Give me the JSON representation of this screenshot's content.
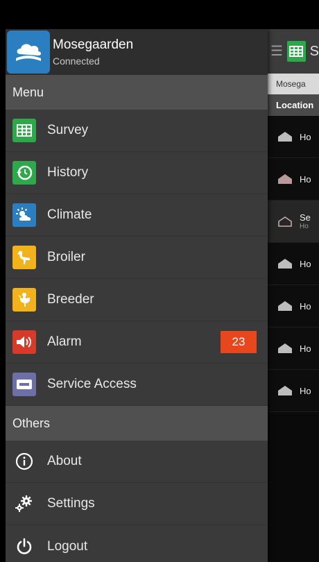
{
  "drawer": {
    "app_title": "Mosegaarden",
    "status": "Connected",
    "menu_section": "Menu",
    "menu_items": [
      {
        "label": "Survey",
        "icon": "grid-icon",
        "color": "#2ea84a"
      },
      {
        "label": "History",
        "icon": "history-icon",
        "color": "#2ea84a"
      },
      {
        "label": "Climate",
        "icon": "climate-icon",
        "color": "#2b7fc1"
      },
      {
        "label": "Broiler",
        "icon": "broiler-icon",
        "color": "#f2b21b"
      },
      {
        "label": "Breeder",
        "icon": "breeder-icon",
        "color": "#f2b21b"
      },
      {
        "label": "Alarm",
        "icon": "alarm-icon",
        "color": "#d83a2a",
        "badge": "23"
      },
      {
        "label": "Service Access",
        "icon": "service-icon",
        "color": "#6f6fa8"
      }
    ],
    "others_section": "Others",
    "other_items": [
      {
        "label": "About",
        "icon": "info-icon"
      },
      {
        "label": "Settings",
        "icon": "gear-icon"
      },
      {
        "label": "Logout",
        "icon": "power-icon"
      }
    ]
  },
  "background": {
    "title": "S",
    "site": "Mosega",
    "header": "Location",
    "rows": [
      {
        "label": "Ho"
      },
      {
        "label": "Ho"
      },
      {
        "label": "Se",
        "sub": "Ho"
      },
      {
        "label": "Ho"
      },
      {
        "label": "Ho"
      },
      {
        "label": "Ho"
      },
      {
        "label": "Ho"
      }
    ]
  },
  "colors": {
    "badge": "#e8471e",
    "brand": "#2b7fc1"
  }
}
